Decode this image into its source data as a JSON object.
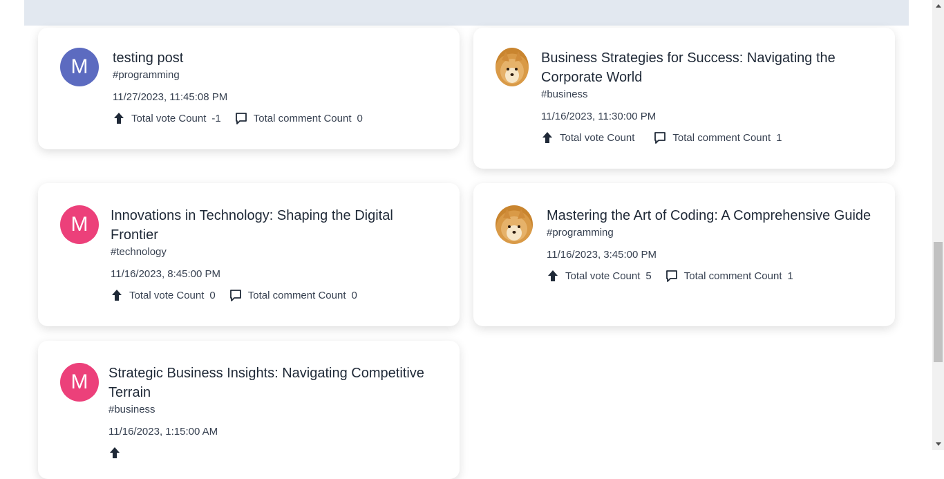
{
  "posts": [
    {
      "title": "testing post",
      "tag": "#programming",
      "date": "11/27/2023, 11:45:08 PM",
      "vote_label": "Total vote Count",
      "vote_count": "-1",
      "comment_label": "Total comment Count",
      "comment_count": "0",
      "avatar_letter": "M",
      "avatar_color": "#5c6bc0"
    },
    {
      "title": "Business Strategies for Success: Navigating the Corporate World",
      "tag": "#business",
      "date": "11/16/2023, 11:30:00 PM",
      "vote_label": "Total vote Count",
      "vote_count": "",
      "comment_label": "Total comment Count",
      "comment_count": "1",
      "avatar_type": "dog"
    },
    {
      "title": "Innovations in Technology: Shaping the Digital Frontier",
      "tag": "#technology",
      "date": "11/16/2023, 8:45:00 PM",
      "vote_label": "Total vote Count",
      "vote_count": "0",
      "comment_label": "Total comment Count",
      "comment_count": "0",
      "avatar_letter": "M",
      "avatar_color": "#ec407a"
    },
    {
      "title": "Mastering the Art of Coding: A Comprehensive Guide",
      "tag": "#programming",
      "date": "11/16/2023, 3:45:00 PM",
      "vote_label": "Total vote Count",
      "vote_count": "5",
      "comment_label": "Total comment Count",
      "comment_count": "1",
      "avatar_type": "dog"
    },
    {
      "title": "Strategic Business Insights: Navigating Competitive Terrain",
      "tag": "#business",
      "date": "11/16/2023, 1:15:00 AM",
      "avatar_letter": "M",
      "avatar_color": "#ec407a"
    }
  ],
  "icons": {
    "vote": "arrow-up-icon",
    "comment": "comment-icon"
  }
}
